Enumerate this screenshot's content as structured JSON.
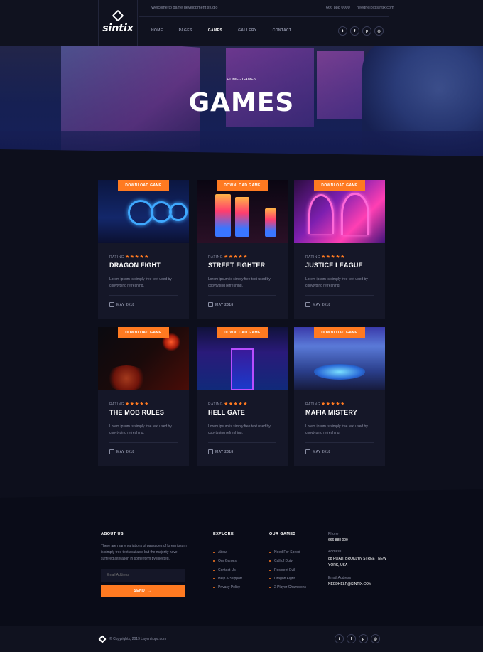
{
  "brand": {
    "name": "sintix"
  },
  "topbar": {
    "welcome": "Welcome to game development studio",
    "phone": "666 888 0000",
    "email": "needhelp@sintix.com"
  },
  "nav": [
    {
      "label": "HOME"
    },
    {
      "label": "PAGES"
    },
    {
      "label": "GAMES",
      "active": true
    },
    {
      "label": "GALLERY"
    },
    {
      "label": "CONTACT"
    }
  ],
  "socials": [
    {
      "icon": "twitter-icon",
      "glyph": "t"
    },
    {
      "icon": "facebook-icon",
      "glyph": "f"
    },
    {
      "icon": "pinterest-icon",
      "glyph": "p"
    },
    {
      "icon": "instagram-icon",
      "glyph": "◎"
    }
  ],
  "hero": {
    "breadcrumb": "HOME - GAMES",
    "title": "GAMES"
  },
  "cards": [
    {
      "button": "DOWNLOAD GAME",
      "rating_label": "RATING",
      "stars": "★★★★★",
      "title": "DRAGON FIGHT",
      "desc": "Lorem ipsum is simply free text used by copytyping refreshing.",
      "date": "MAY 2018"
    },
    {
      "button": "DOWNLOAD GAME",
      "rating_label": "RATING",
      "stars": "★★★★★",
      "title": "STREET FIGHTER",
      "desc": "Lorem ipsum is simply free text used by copytyping refreshing.",
      "date": "MAY 2018"
    },
    {
      "button": "DOWNLOAD GAME",
      "rating_label": "RATING",
      "stars": "★★★★★",
      "title": "JUSTICE LEAGUE",
      "desc": "Lorem ipsum is simply free text used by copytyping refreshing.",
      "date": "MAY 2018"
    },
    {
      "button": "DOWNLOAD GAME",
      "rating_label": "RATING",
      "stars": "★★★★★",
      "title": "THE MOB RULES",
      "desc": "Lorem ipsum is simply free text used by copytyping refreshing.",
      "date": "MAY 2018"
    },
    {
      "button": "DOWNLOAD GAME",
      "rating_label": "RATING",
      "stars": "★★★★★",
      "title": "HELL GATE",
      "desc": "Lorem ipsum is simply free text used by copytyping refreshing.",
      "date": "MAY 2018"
    },
    {
      "button": "DOWNLOAD GAME",
      "rating_label": "RATING",
      "stars": "★★★★★",
      "title": "MAFIA MISTERY",
      "desc": "Lorem ipsum is simply free text used by copytyping refreshing.",
      "date": "MAY 2018"
    }
  ],
  "footer": {
    "about": {
      "heading": "ABOUT US",
      "text": "There are many variations of passages of lorem ipsum is simply free text available but the majority have suffered alteration in some form by injected.",
      "email_placeholder": "Email Address",
      "send_label": "SEND"
    },
    "explore": {
      "heading": "EXPLORE",
      "links": [
        "About",
        "Our Games",
        "Contact Us",
        "Help & Support",
        "Privacy Policy"
      ]
    },
    "games": {
      "heading": "OUR GAMES",
      "links": [
        "Need For Speed",
        "Call of Duty",
        "Resident Evil",
        "Dragon Fight",
        "2 Player Champions"
      ]
    },
    "contact": {
      "phone_label": "Phone",
      "phone": "666 888 000",
      "address_label": "Address",
      "address_line1": "88 ROAD, BROKLYN STREET NEW",
      "address_line2": "YORK, USA",
      "email_label": "Email Address",
      "email": "NEEDHELP@SINTIX.COM"
    }
  },
  "bottom": {
    "copyright": "© Copyrights, 2019 Layerdrops.com"
  },
  "colors": {
    "accent": "#ff7a21",
    "background": "#0d0f1c",
    "card": "#151728"
  }
}
